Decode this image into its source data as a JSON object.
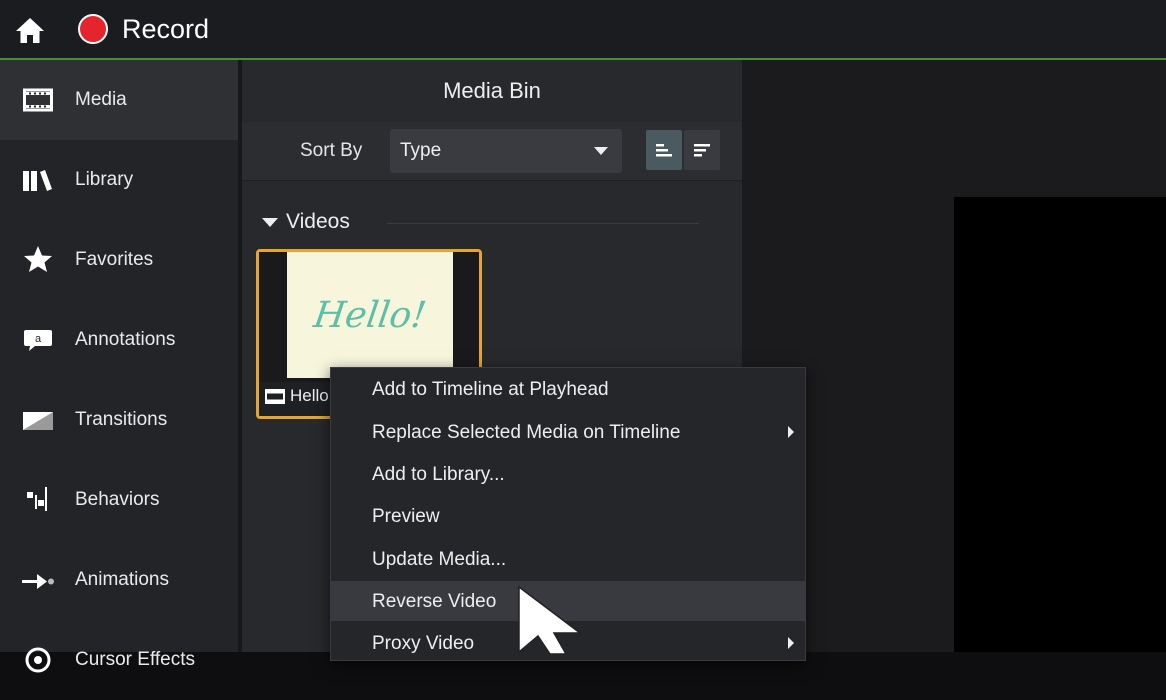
{
  "topbar": {
    "record_label": "Record"
  },
  "sidebar": {
    "items": [
      {
        "label": "Media",
        "icon": "film-icon",
        "active": true
      },
      {
        "label": "Library",
        "icon": "books-icon"
      },
      {
        "label": "Favorites",
        "icon": "star-icon"
      },
      {
        "label": "Annotations",
        "icon": "speech-bubble-icon"
      },
      {
        "label": "Transitions",
        "icon": "transition-icon"
      },
      {
        "label": "Behaviors",
        "icon": "behaviors-icon"
      },
      {
        "label": "Animations",
        "icon": "arrow-icon"
      },
      {
        "label": "Cursor Effects",
        "icon": "cursor-effects-icon"
      }
    ]
  },
  "media_bin": {
    "title": "Media Bin",
    "sort_label": "Sort By",
    "sort_value": "Type",
    "section_label": "Videos",
    "clip": {
      "thumbnail_text": "Hello!",
      "caption": "Hello"
    }
  },
  "context_menu": {
    "items": [
      {
        "label": "Add to Timeline at Playhead",
        "submenu": false
      },
      {
        "label": "Replace Selected Media on Timeline",
        "submenu": true
      },
      {
        "label": "Add to Library...",
        "submenu": false
      },
      {
        "label": "Preview",
        "submenu": false
      },
      {
        "label": "Update Media...",
        "submenu": false
      },
      {
        "label": "Reverse Video",
        "submenu": false,
        "highlighted": true
      },
      {
        "label": "Proxy Video",
        "submenu": true
      }
    ]
  },
  "colors": {
    "accent_green": "#4a8f2a",
    "record_red": "#e5252b",
    "selection_orange": "#e5a52e",
    "thumbnail_text": "#5cbfa7"
  }
}
